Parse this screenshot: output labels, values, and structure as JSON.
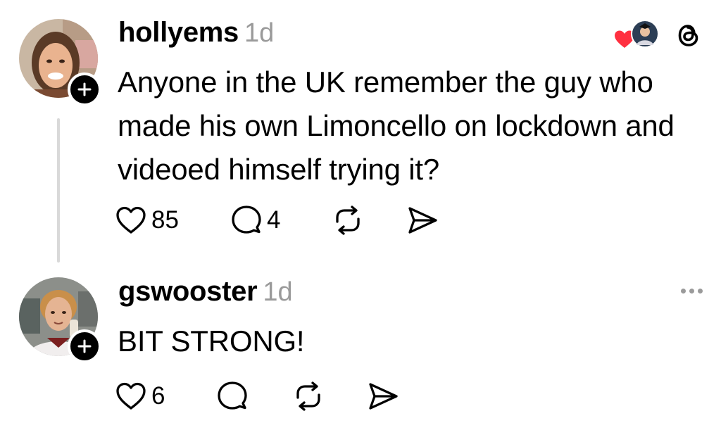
{
  "posts": [
    {
      "username": "hollyems",
      "timestamp": "1d",
      "text": "Anyone in the UK remember the guy who made his own Limoncello on lockdown and videoed himself trying it?",
      "likes": "85",
      "replies": "4",
      "avatar_icon": "user-avatar",
      "badge_icon": "plus-icon"
    },
    {
      "username": "gswooster",
      "timestamp": "1d",
      "text": "BIT STRONG!",
      "likes": "6",
      "replies": "",
      "avatar_icon": "user-avatar",
      "badge_icon": "plus-icon"
    }
  ],
  "icons": {
    "like": "heart-icon",
    "reply": "comment-icon",
    "repost": "repost-icon",
    "share": "send-icon",
    "app": "threads-logo-icon",
    "more": "more-dots-icon"
  },
  "colors": {
    "text": "#000000",
    "muted": "#9a9a9a",
    "thread_line": "#d9d9d9",
    "like_heart": "#ff3040"
  }
}
